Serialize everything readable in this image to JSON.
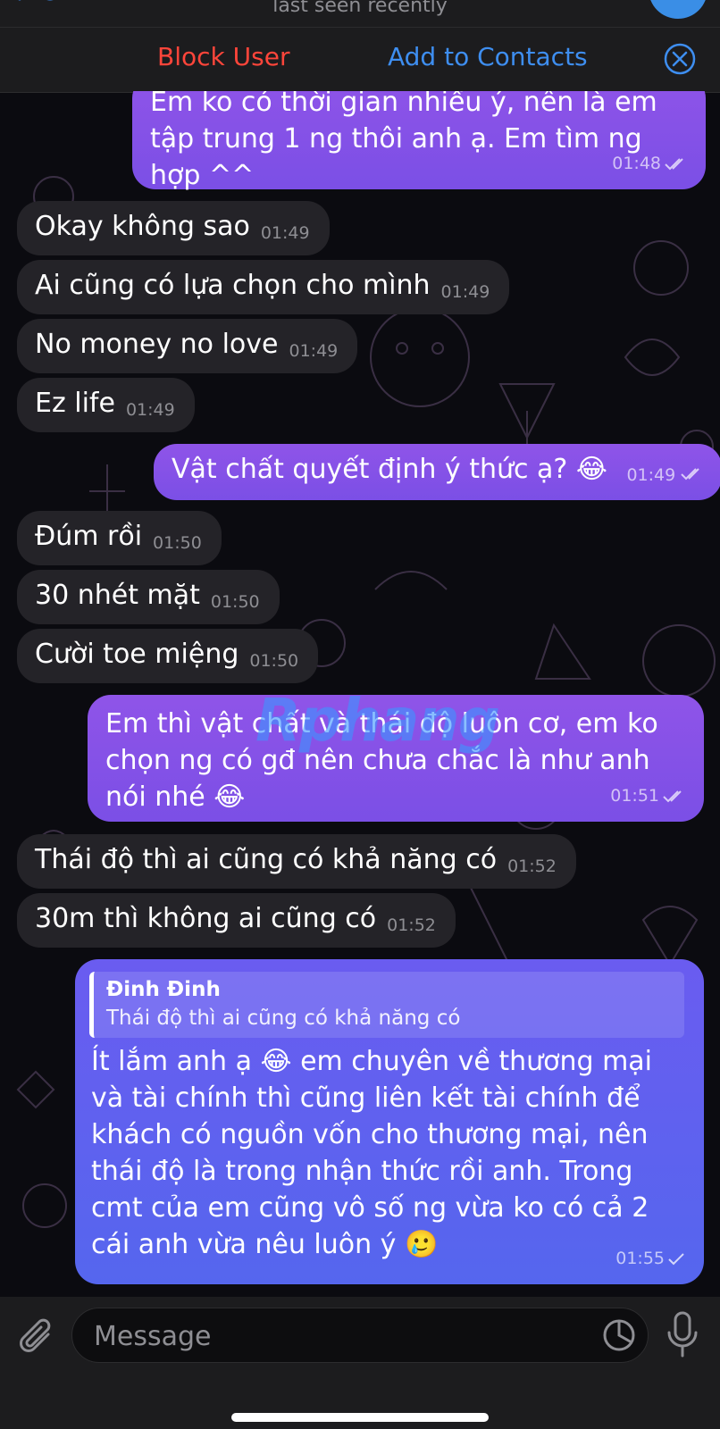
{
  "header": {
    "status": "last seen recently",
    "block_user": "Block User",
    "add_to_contacts": "Add to Contacts"
  },
  "messages": [
    {
      "dir": "out",
      "text": "Em ko có thời gian nhiều ý, nên là em tập trung 1 ng thôi anh ạ. Em tìm ng hợp ^^",
      "time": "01:48",
      "status": "read"
    },
    {
      "dir": "in",
      "text": "Okay không sao",
      "time": "01:49"
    },
    {
      "dir": "in",
      "text": "Ai cũng có lựa chọn cho mình",
      "time": "01:49"
    },
    {
      "dir": "in",
      "text": "No money no love",
      "time": "01:49"
    },
    {
      "dir": "in",
      "text": "Ez life",
      "time": "01:49"
    },
    {
      "dir": "out",
      "text": "Vật chất quyết định ý thức ạ? 😂",
      "time": "01:49",
      "status": "read"
    },
    {
      "dir": "in",
      "text": "Đúm rồi",
      "time": "01:50"
    },
    {
      "dir": "in",
      "text": "30 nhét mặt",
      "time": "01:50"
    },
    {
      "dir": "in",
      "text": "Cười toe miệng",
      "time": "01:50"
    },
    {
      "dir": "out",
      "text": "Em thì vật chất và thái độ luôn cơ, em ko chọn ng có gđ nên chưa chắc là như anh nói nhé 😂",
      "time": "01:51",
      "status": "read"
    },
    {
      "dir": "in",
      "text": "Thái độ thì ai cũng có khả năng có",
      "time": "01:52"
    },
    {
      "dir": "in",
      "text": "30m thì không ai cũng có",
      "time": "01:52"
    },
    {
      "dir": "out",
      "reply_name": "Đinh Đinh",
      "reply_text": "Thái độ thì ai cũng có khả năng có",
      "text": "Ít lắm anh ạ 😂 em chuyên về thương mại và tài chính thì cũng liên kết tài chính để khách có nguồn vốn cho thương mại, nên thái độ là trong nhận thức rồi anh. Trong cmt của em cũng vô số ng vừa ko có cả 2 cái anh vừa nêu luôn ý 🥲",
      "time": "01:55",
      "status": "sent"
    }
  ],
  "watermark": {
    "part1": "Rphang",
    "part2": ""
  },
  "input": {
    "placeholder": "Message"
  },
  "colors": {
    "incoming": "#242328",
    "outgoing": "#8f54e8",
    "block": "#ff453a",
    "link": "#3e8ef0"
  },
  "icons": [
    "back-icon",
    "avatar",
    "close-circle-icon",
    "paperclip-icon",
    "sticker-icon",
    "microphone-icon",
    "double-check-icon",
    "check-icon"
  ]
}
